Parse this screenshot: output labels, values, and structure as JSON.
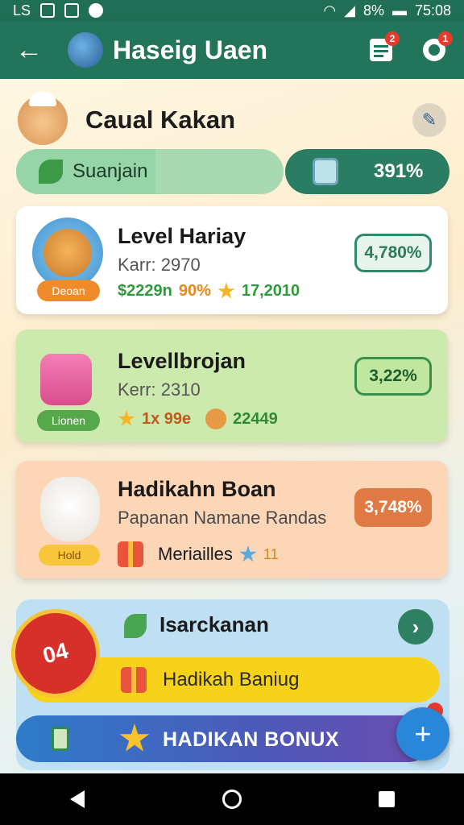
{
  "status_bar": {
    "left_text": "LS",
    "battery_text": "8%",
    "time": "75:08"
  },
  "app_bar": {
    "title": "Haseig Uaen",
    "badge_left": "2",
    "badge_right": "1"
  },
  "profile": {
    "name": "Caual Kakan"
  },
  "progress": {
    "left_label": "Suanjain",
    "left_fraction": 0.52,
    "right_value": "391%"
  },
  "cards": [
    {
      "title": "Level Hariay",
      "subtitle": "Karr: 2970",
      "tag": "Deoan",
      "stat_money": "$2229n",
      "stat_pct": "90%",
      "stat_score": "17,2010",
      "pill": "4,780%"
    },
    {
      "title": "Levellbrojan",
      "subtitle": "Kerr: 2310",
      "tag": "Lionen",
      "stat_stars": "1x 99e",
      "stat_score": "22449",
      "pill": "3,22%"
    },
    {
      "title": "Hadikahn Boan",
      "subtitle": "Papanan Namane Randas",
      "tag": "Hold",
      "item_label": "Meriailles",
      "item_count": "11",
      "pill": "3,748%"
    }
  ],
  "bottom_panel": {
    "title": "Isarckanan",
    "yellow_button": "Hadikah Baniug",
    "burst_label": "04"
  },
  "cta": {
    "label": "HADIKAN BONUX",
    "fab_symbol": "+"
  },
  "colors": {
    "app_bar": "#22745a",
    "accent_green": "#2a7d62",
    "cta_blue": "#2e7cc9",
    "fab": "#2a86d8"
  }
}
